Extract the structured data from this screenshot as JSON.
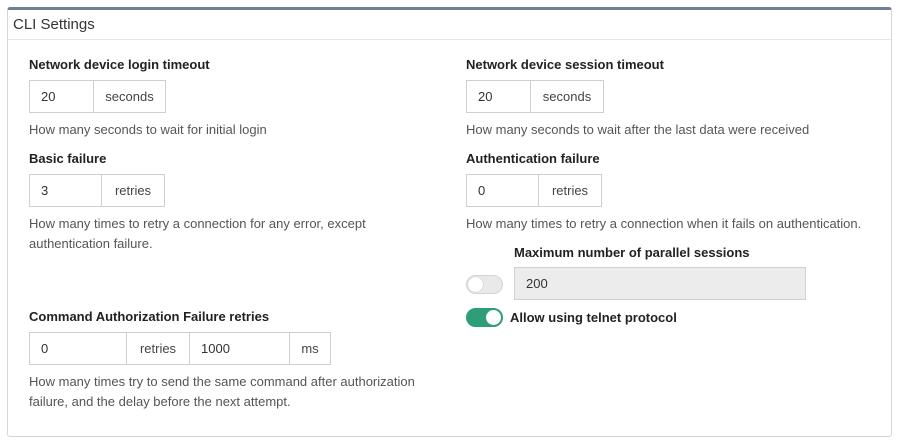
{
  "panel": {
    "title": "CLI Settings"
  },
  "login_timeout": {
    "label": "Network device login timeout",
    "value": "20",
    "unit": "seconds",
    "help": "How many seconds to wait for initial login"
  },
  "session_timeout": {
    "label": "Network device session timeout",
    "value": "20",
    "unit": "seconds",
    "help": "How many seconds to wait after the last data were received"
  },
  "basic_failure": {
    "label": "Basic failure",
    "value": "3",
    "unit": "retries",
    "help_line1": "How many times to retry a connection for any error, except",
    "help_line2": "authentication failure."
  },
  "auth_failure": {
    "label": "Authentication failure",
    "value": "0",
    "unit": "retries",
    "help": "How many times to retry a connection when it fails on authentication."
  },
  "parallel_sessions": {
    "label": "Maximum number of parallel sessions",
    "value": "200",
    "toggle_on": false
  },
  "telnet": {
    "label": "Allow using telnet protocol",
    "toggle_on": true
  },
  "cmd_auth_failure": {
    "label": "Command Authorization Failure retries",
    "retries_value": "0",
    "retries_unit": "retries",
    "delay_value": "1000",
    "delay_unit": "ms",
    "help_line1": "How many times try to send the same command after authorization",
    "help_line2": "failure, and the delay before the next attempt."
  },
  "colors": {
    "accent": "#2e9e78",
    "header_border": "#6f7f96",
    "disabled_bg": "#ececec"
  }
}
